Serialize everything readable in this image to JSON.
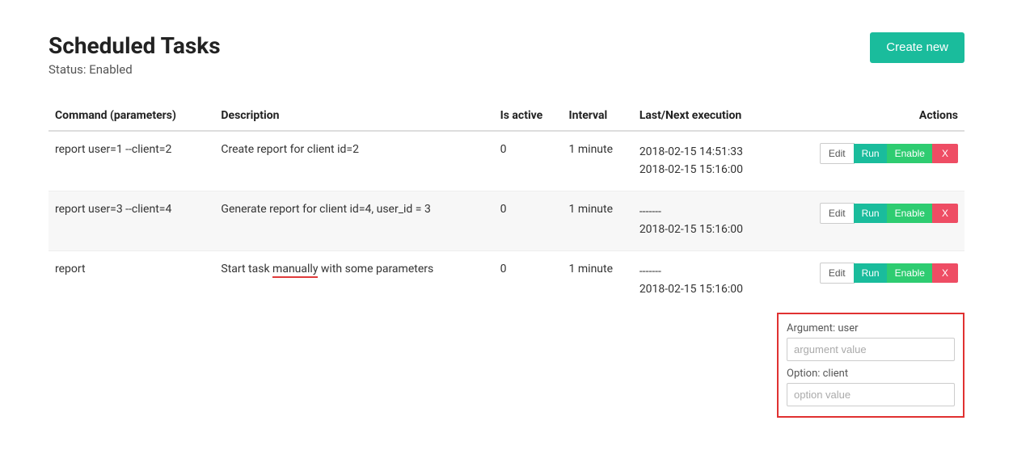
{
  "header": {
    "title": "Scheduled Tasks",
    "status_prefix": "Status: ",
    "status_value": "Enabled",
    "create_button": "Create new"
  },
  "table": {
    "headers": {
      "command": "Command (parameters)",
      "description": "Description",
      "is_active": "Is active",
      "interval": "Interval",
      "execution": "Last/Next execution",
      "actions": "Actions"
    },
    "rows": [
      {
        "command": "report user=1 --client=2",
        "description": "Create report for client id=2",
        "is_active": "0",
        "interval": "1 minute",
        "last_exec": "2018-02-15 14:51:33",
        "next_exec": "2018-02-15 15:16:00"
      },
      {
        "command": "report user=3 --client=4",
        "description": "Generate report for client id=4, user_id = 3",
        "is_active": "0",
        "interval": "1 minute",
        "last_exec": "-------",
        "next_exec": "2018-02-15 15:16:00"
      },
      {
        "command": "report",
        "description_pre": "Start task ",
        "description_underlined": "manually",
        "description_post": " with some parameters",
        "is_active": "0",
        "interval": "1 minute",
        "last_exec": "-------",
        "next_exec": "2018-02-15 15:16:00"
      }
    ],
    "action_labels": {
      "edit": "Edit",
      "run": "Run",
      "enable": "Enable",
      "delete": "X"
    }
  },
  "param_panel": {
    "arg_label": "Argument: user",
    "arg_placeholder": "argument value",
    "opt_label": "Option: client",
    "opt_placeholder": "option value"
  }
}
